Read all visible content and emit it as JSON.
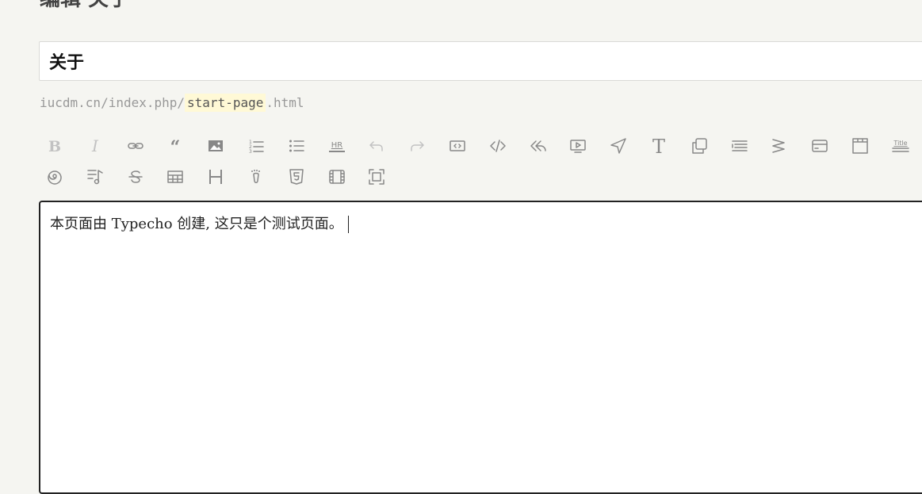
{
  "page": {
    "heading": "编辑 关于"
  },
  "title_field": {
    "value": "关于"
  },
  "permalink": {
    "prefix": "iucdm.cn/index.php/",
    "slug": "start-page",
    "suffix": ".html"
  },
  "toolbar": {
    "row1": [
      {
        "icon": "bold-icon",
        "label": "B",
        "dim": true
      },
      {
        "icon": "italic-icon",
        "label": "I",
        "dim": true
      },
      {
        "icon": "link-icon",
        "dim": false
      },
      {
        "icon": "quote-icon",
        "dim": false
      },
      {
        "icon": "image-icon",
        "dim": false
      },
      {
        "icon": "ordered-list-icon",
        "dim": false
      },
      {
        "icon": "unordered-list-icon",
        "dim": false
      },
      {
        "icon": "hr-icon",
        "label": "HR",
        "dim": false
      },
      {
        "icon": "undo-icon",
        "dim": true
      },
      {
        "icon": "redo-icon",
        "dim": true
      },
      {
        "icon": "code-block-icon",
        "dim": false
      },
      {
        "icon": "code-icon",
        "dim": false
      },
      {
        "icon": "reply-all-icon",
        "dim": false
      },
      {
        "icon": "video-icon",
        "dim": false
      },
      {
        "icon": "send-icon",
        "dim": false
      },
      {
        "icon": "text-icon",
        "label": "T",
        "dim": false
      },
      {
        "icon": "copy-icon",
        "dim": false
      },
      {
        "icon": "align-left-icon",
        "dim": false
      },
      {
        "icon": "collapse-icon",
        "dim": false
      },
      {
        "icon": "card-icon",
        "dim": false
      },
      {
        "icon": "tabs-icon",
        "dim": false
      },
      {
        "icon": "title-icon",
        "label": "Title",
        "dim": false
      },
      {
        "icon": "lightbulb-icon",
        "dim": false
      }
    ],
    "row2": [
      {
        "icon": "spiral-icon",
        "dim": false
      },
      {
        "icon": "music-icon",
        "dim": false
      },
      {
        "icon": "strikethrough-icon",
        "dim": false
      },
      {
        "icon": "table-icon",
        "dim": false
      },
      {
        "icon": "heading-icon",
        "label": "H",
        "dim": false
      },
      {
        "icon": "footprint-icon",
        "dim": false
      },
      {
        "icon": "html5-icon",
        "dim": false
      },
      {
        "icon": "film-icon",
        "dim": false
      },
      {
        "icon": "fullscreen-icon",
        "dim": false
      }
    ]
  },
  "editor": {
    "content": "本页面由 Typecho 创建, 这只是个测试页面。"
  }
}
